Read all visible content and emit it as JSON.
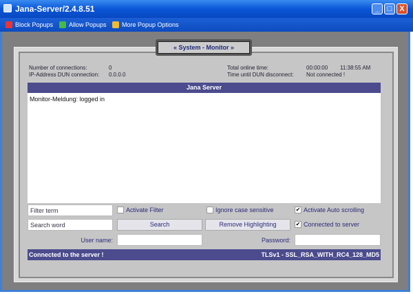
{
  "window": {
    "title": "Jana-Server/2.4.8.51",
    "minimize": "_",
    "maximize": "□",
    "close": "X"
  },
  "menu": [
    {
      "label": "Block Popups",
      "icon": "block-popups-icon"
    },
    {
      "label": "Allow Popups",
      "icon": "allow-popups-icon"
    },
    {
      "label": "More Popup Options",
      "icon": "popup-options-icon"
    }
  ],
  "monitor": {
    "title": "« System - Monitor »",
    "connections_label": "Number of connections:",
    "connections_value": "0",
    "ip_label": "IP-Address DUN connection:",
    "ip_value": "0.0.0.0",
    "online_label": "Total online time:",
    "online_value": "00:00:00",
    "clock": "11:38:55 AM",
    "dun_label": "Time until DUN disconnect:",
    "dun_value": "Not connected !"
  },
  "log": {
    "header": "Jana Server",
    "lines": [
      "Monitor-Meldung: logged in"
    ]
  },
  "controls": {
    "filter_value": "Filter term",
    "activate_filter": "Activate Filter",
    "activate_filter_checked": false,
    "ignore_case": "Ignore case sensitive",
    "ignore_case_checked": false,
    "auto_scroll": "Activate Auto scrolling",
    "auto_scroll_checked": true,
    "search_value": "Search word",
    "search_button": "Search",
    "remove_button": "Remove Highlighting",
    "connected": "Connected to server",
    "connected_checked": true,
    "username_label": "User name:",
    "username_value": "",
    "password_label": "Password:",
    "password_value": ""
  },
  "status": {
    "left": "Connected to the server !",
    "right": "TLSv1 - SSL_RSA_WITH_RC4_128_MD5"
  },
  "colors": {
    "accent": "#4b4b8d",
    "titlebar": "#0a56d8"
  }
}
